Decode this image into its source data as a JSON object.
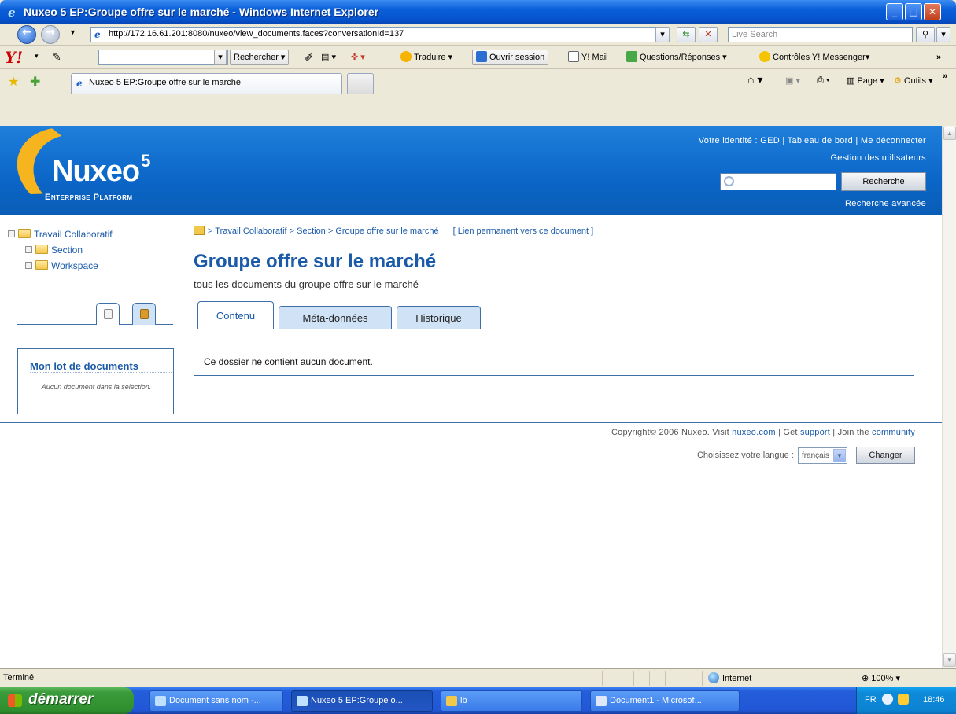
{
  "window": {
    "title": "Nuxeo 5 EP:Groupe offre sur le marché - Windows Internet Explorer",
    "buttons": [
      "_",
      "□",
      "✕"
    ]
  },
  "address_bar": {
    "url": "http://172.16.61.201:8080/nuxeo/view_documents.faces?conversationId=137",
    "search_placeholder": "Live Search"
  },
  "yahoo_toolbar": {
    "search_button": "Rechercher",
    "translate": "Traduire",
    "login": "Ouvrir session",
    "mail": "Y! Mail",
    "answers": "Questions/Réponses",
    "messenger": "Contrôles Y! Messenger"
  },
  "browser_tab": {
    "label": "Nuxeo 5 EP:Groupe offre sur le marché"
  },
  "command_bar": {
    "page": "Page",
    "tools": "Outils"
  },
  "nuxeo": {
    "brand": "Nuxeo",
    "version": "5",
    "subtitle": "Enterprise Platform",
    "header_links": "Votre identité : GED | Tableau de bord | Me déconnecter",
    "users_link": "Gestion des utilisateurs",
    "search_button": "Recherche",
    "advanced_search": "Recherche avancée"
  },
  "tree": {
    "root": "Travail Collaboratif",
    "children": [
      "Section",
      "Workspace"
    ]
  },
  "clipboard": {
    "title": "Mon lot de documents",
    "empty": "Aucun document dans la selection."
  },
  "breadcrumb": {
    "path": "> Travail Collaboratif > Section > Groupe offre sur le marché",
    "permalink": "[ Lien permanent vers ce document ]"
  },
  "document": {
    "title": "Groupe offre sur le marché",
    "description": "tous les documents du groupe offre sur le marché",
    "tabs": [
      "Contenu",
      "Méta-données",
      "Historique"
    ],
    "empty_message": "Ce dossier ne contient aucun document."
  },
  "footer": {
    "copyright_prefix": "Copyright© 2006 Nuxeo. Visit",
    "site": "nuxeo.com",
    "get": "| Get",
    "support": "support",
    "join": "| Join the",
    "community": "community",
    "language_label": "Choisissez votre langue :",
    "language_value": "français",
    "change_button": "Changer"
  },
  "status_bar": {
    "status": "Terminé",
    "zone": "Internet",
    "zoom": "100%"
  },
  "taskbar": {
    "start": "démarrer",
    "tasks": [
      "Document sans nom -...",
      "Nuxeo 5 EP:Groupe o...",
      "lb",
      "Document1 - Microsof..."
    ],
    "lang": "FR",
    "clock": "18:46"
  }
}
